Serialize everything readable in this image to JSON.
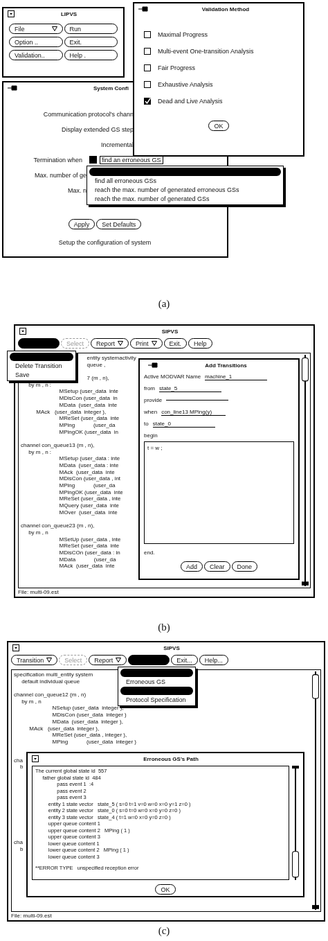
{
  "panel_a": {
    "main_window": {
      "title": "LIPVS",
      "buttons": [
        {
          "label": "File",
          "menu": true
        },
        {
          "label": "Run",
          "menu": false
        },
        {
          "label": "Option ..",
          "menu": false
        },
        {
          "label": "Exit.",
          "menu": false
        },
        {
          "label": "Validation..",
          "menu": false
        },
        {
          "label": "Help .",
          "menu": false
        }
      ]
    },
    "config_window": {
      "title": "System Confi",
      "rows": [
        {
          "kind": "label",
          "label": "Communication protocol's chann"
        },
        {
          "kind": "label",
          "label": "Display extended GS step"
        },
        {
          "kind": "label",
          "label": "Incremental"
        },
        {
          "kind": "choice",
          "label": "Termination when",
          "value": "find an erroneous GS"
        },
        {
          "kind": "clipped",
          "label": "Max. number of ge"
        },
        {
          "kind": "clipped",
          "label": "Max. n"
        }
      ],
      "dropdown": [
        {
          "kind": "blank",
          "selected": true
        },
        {
          "kind": "item",
          "label": "find all erroneous GSs",
          "selected": false
        },
        {
          "kind": "item",
          "label": "reach the max. number of generated erroneous GSs",
          "selected": false
        },
        {
          "kind": "item",
          "label": "reach the max. number of generated GSs",
          "selected": false
        }
      ],
      "buttons": [
        "Apply",
        "Set Defaults"
      ],
      "footer": "Setup the configuration of system"
    },
    "validation_window": {
      "title": "Validation Method",
      "options": [
        {
          "label": "Maximal Progress",
          "checked": false
        },
        {
          "label": "Multi-event One-transition Analysis",
          "checked": false
        },
        {
          "label": "Fair Progress",
          "checked": false
        },
        {
          "label": "Exhaustive Analysis",
          "checked": false
        },
        {
          "label": "Dead and Live Analysis",
          "checked": true
        }
      ],
      "button": "OK"
    },
    "caption": "(a)"
  },
  "panel_b": {
    "window": {
      "title": "SIPVS",
      "toolbar": [
        {
          "kind": "pressed"
        },
        {
          "kind": "button",
          "label": "Select",
          "menu": false,
          "disabled": true
        },
        {
          "kind": "button",
          "label": "Report",
          "menu": true,
          "disabled": false
        },
        {
          "kind": "button",
          "label": "Print",
          "menu": true,
          "disabled": false
        },
        {
          "kind": "button",
          "label": "Exit.",
          "menu": false,
          "disabled": false
        },
        {
          "kind": "button",
          "label": "Help",
          "menu": false,
          "disabled": false
        }
      ],
      "menu": [
        {
          "kind": "blank",
          "selected": true
        },
        {
          "kind": "item",
          "label": "Delete Transition",
          "selected": false
        },
        {
          "kind": "item",
          "label": "Save",
          "selected": false
        }
      ],
      "code": [
        [
          "                                           entity systemactivity",
          "                                           queue ,"
        ],
        [
          "                                           7 (m , n),",
          "     by m , n :",
          "                         MSetup (user_data  inte",
          "                         MDisCon (user_data  in",
          "                         MData  (user_data  inte",
          "          MAck   (user_data  integer ),",
          "                         MReSet (user_data  inte",
          "                         MPing            (user_da",
          "                         MPingOK (user_data  in"
        ],
        [
          "channel con_queue13 (m , n),",
          "     by m , n :",
          "                         MSetup (user_data : inte",
          "                         MData  (user_data : inte",
          "                         MAck  (user_data  inte",
          "                         MDisCon (user_data , int",
          "                         MPing            (user_da",
          "                         MPingOK (user_data  inte",
          "                         MReSet (user_data , inte",
          "                         MQuery (user_data  inte",
          "                         MOver  (user_data  inte"
        ],
        [
          "channel con_queue23 (m , n),",
          "     by m , n",
          "                         MSetUp (user_data , inte",
          "                         MReSet (user_data  inte",
          "                         MDisCOn (user_data : in",
          "                         MData            (user_da",
          "                         MAck  (user_data  inte"
        ]
      ],
      "status": "File: multi-09.est"
    },
    "dialog": {
      "title": "Add Transitions",
      "fields": [
        {
          "label": "Active MODVAR Name",
          "value": "machine_1"
        },
        {
          "label": "from",
          "value": "state_5"
        },
        {
          "label": "provide"
        },
        {
          "label": "when",
          "value": "con_line13 MPing(y)"
        },
        {
          "label": "to",
          "value": "state_0"
        }
      ],
      "begin_label": "begin",
      "body": "t = w ;",
      "end_label": "end.",
      "buttons": [
        "Add",
        "Clear",
        "Done"
      ]
    },
    "caption": "(b)"
  },
  "panel_c": {
    "window": {
      "title": "SIPVS",
      "toolbar": [
        {
          "kind": "button",
          "label": "Transition",
          "menu": true,
          "disabled": false
        },
        {
          "kind": "button",
          "label": "Select",
          "menu": false,
          "disabled": true
        },
        {
          "kind": "button",
          "label": "Report",
          "menu": true,
          "disabled": false
        },
        {
          "kind": "pressed"
        },
        {
          "kind": "button",
          "label": "Exit...",
          "menu": false,
          "disabled": false
        },
        {
          "kind": "button",
          "label": "Help...",
          "menu": false,
          "disabled": false
        }
      ],
      "menu": [
        {
          "kind": "blank",
          "selected": true
        },
        {
          "kind": "item",
          "label": "Erroneous GS",
          "selected": false
        },
        {
          "kind": "blank",
          "selected": true
        },
        {
          "kind": "item",
          "label": "Protocol Specification",
          "selected": false
        }
      ],
      "code": [
        [
          "specification multi_entity system",
          "     default individual queue"
        ],
        [
          "channel con_queue12 (m , n)",
          "     by m , n",
          "                         NSetup (user_data  integer ),",
          "                         MDisCon (user_data  integer )",
          "                         MData  (user_data  integer ),",
          "          MAck   (user_data  integer ),",
          "                         MReSet (user_data , integer ),",
          "                         MPing            (user_data  integer )"
        ]
      ],
      "covered_lines": [
        [
          "cha",
          "    b"
        ],
        [
          "cha",
          "    b"
        ]
      ],
      "status": "File: multi-09.est"
    },
    "dialog": {
      "title": "Erroneous GS's Path",
      "lines": [
        "The current global state id  557",
        "     father global state id  484",
        "               pass event 1  :4",
        "               pass event 2",
        "               pass event 3",
        "         entity 1 state vector   state_5 ( s=0 t=1 v=0 w=0 x=0 y=1 z=0 )",
        "         entity 2 state vector   state_0 ( s=0 t=0 w=0 x=0 y=0 z=0 )",
        "         entity 3 state vector   state_4 ( t=1 w=0 x=0 y=0 z=0 )",
        "         upper queue content 1",
        "         upper queue content 2   MPing ( 1 )",
        "         upper queue content 3",
        "         lower queue content 1",
        "         lower queue content 2   MPing ( 1 )",
        "         lower queue content 3",
        "**ERROR TYPE   unspecified reception error"
      ],
      "button": "OK"
    },
    "caption": "(c)"
  }
}
